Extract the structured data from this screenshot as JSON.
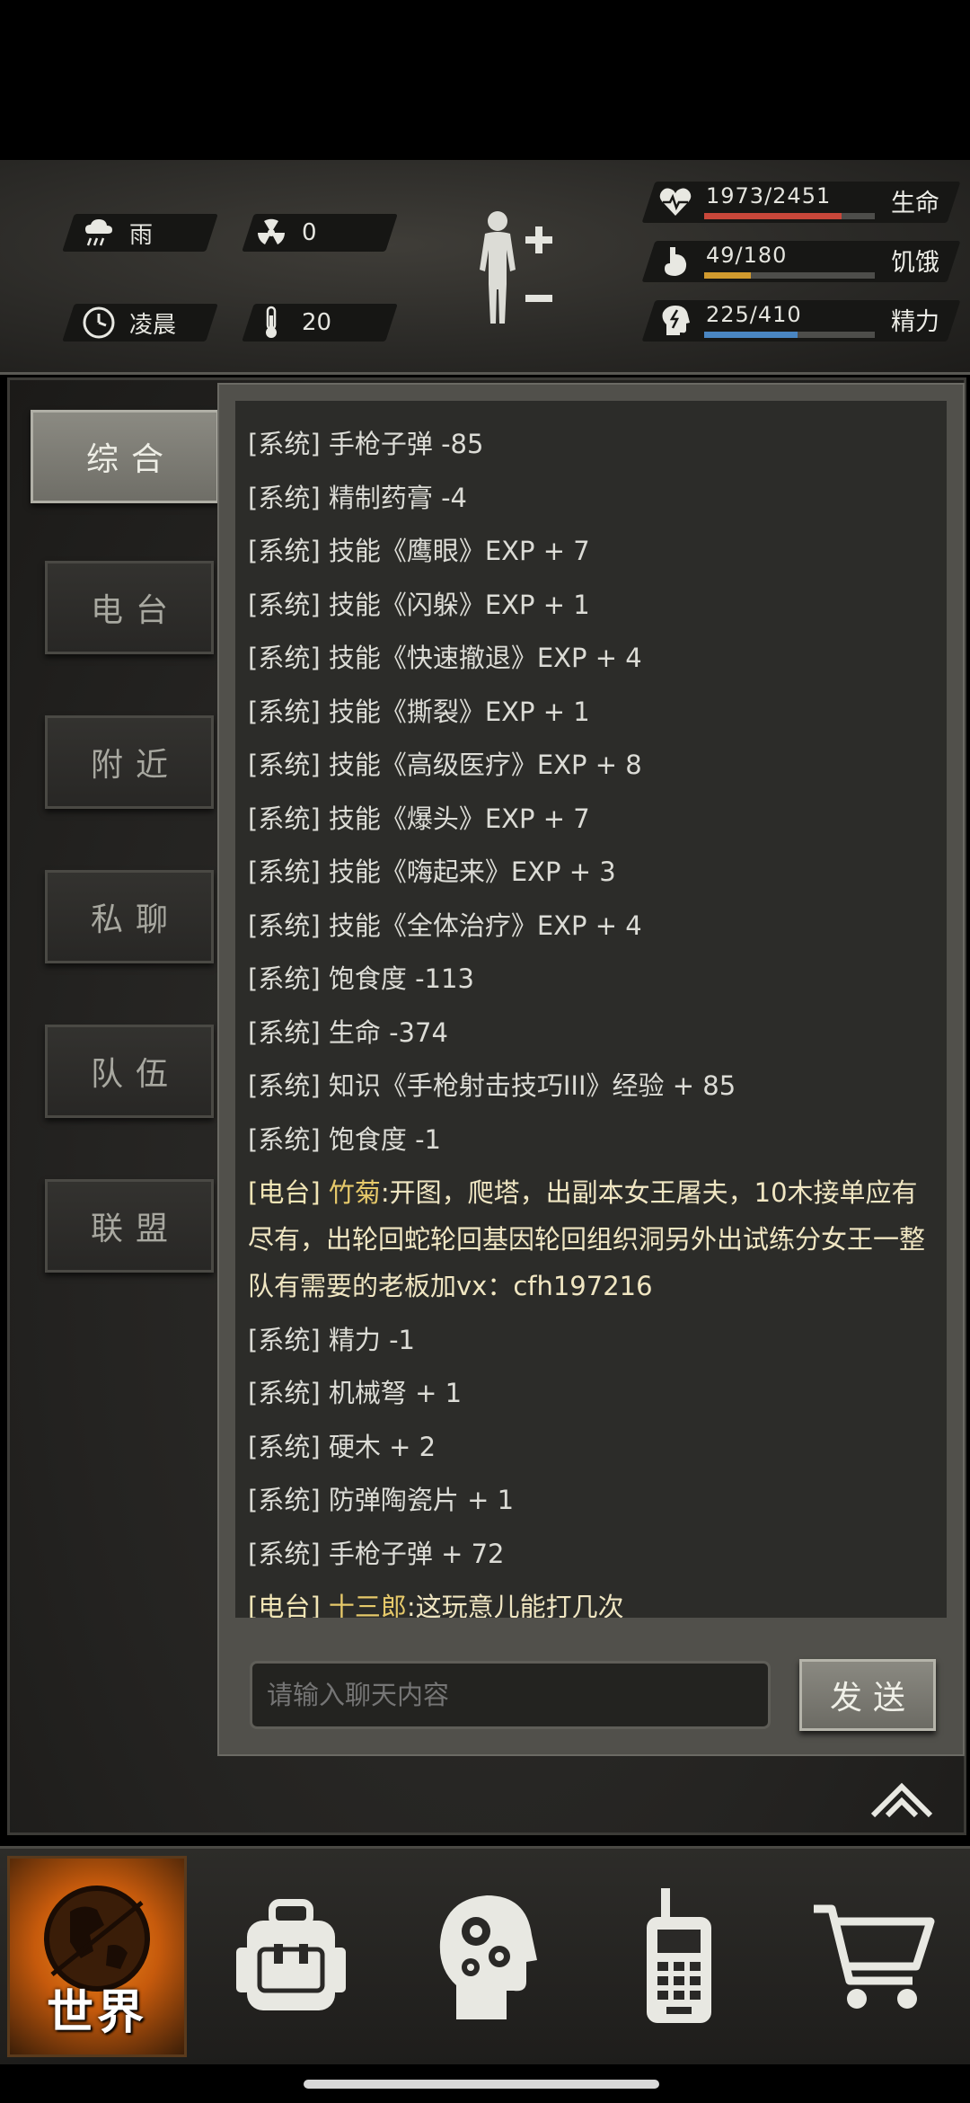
{
  "status": {
    "weather": "雨",
    "radiation": "0",
    "time_of_day": "凌晨",
    "temperature": "20",
    "stats": [
      {
        "value": "1973/2451",
        "label": "生命",
        "color": "#c8473a",
        "fraction": 0.805
      },
      {
        "value": "49/180",
        "label": "饥饿",
        "color": "#d19a2e",
        "fraction": 0.272
      },
      {
        "value": "225/410",
        "label": "精力",
        "color": "#4a86c2",
        "fraction": 0.549
      }
    ]
  },
  "tabs": [
    {
      "label": "综合",
      "active": true
    },
    {
      "label": "电台",
      "active": false
    },
    {
      "label": "附近",
      "active": false
    },
    {
      "label": "私聊",
      "active": false
    },
    {
      "label": "队伍",
      "active": false
    },
    {
      "label": "联盟",
      "active": false
    }
  ],
  "chat": {
    "messages": [
      {
        "tag": "[系统]",
        "text": "手枪子弹 -85"
      },
      {
        "tag": "[系统]",
        "text": "精制药膏 -4"
      },
      {
        "tag": "[系统]",
        "text": "技能《鹰眼》EXP + 7"
      },
      {
        "tag": "[系统]",
        "text": "技能《闪躲》EXP + 1"
      },
      {
        "tag": "[系统]",
        "text": "技能《快速撤退》EXP + 4"
      },
      {
        "tag": "[系统]",
        "text": "技能《撕裂》EXP + 1"
      },
      {
        "tag": "[系统]",
        "text": "技能《高级医疗》EXP + 8"
      },
      {
        "tag": "[系统]",
        "text": "技能《爆头》EXP + 7"
      },
      {
        "tag": "[系统]",
        "text": "技能《嗨起来》EXP + 3"
      },
      {
        "tag": "[系统]",
        "text": "技能《全体治疗》EXP + 4"
      },
      {
        "tag": "[系统]",
        "text": "饱食度 -113"
      },
      {
        "tag": "[系统]",
        "text": "生命 -374"
      },
      {
        "tag": "[系统]",
        "text": "知识《手枪射击技巧III》经验 + 85"
      },
      {
        "tag": "[系统]",
        "text": "饱食度 -1"
      },
      {
        "tag": "[电台]",
        "name": "竹菊",
        "text": ":开图，爬塔，出副本女王屠夫，10木接单应有尽有，出轮回蛇轮回基因轮回组织洞另外出试练分女王一整队有需要的老板加vx：cfh197216"
      },
      {
        "tag": "[系统]",
        "text": "精力 -1"
      },
      {
        "tag": "[系统]",
        "text": "机械弩 + 1"
      },
      {
        "tag": "[系统]",
        "text": "硬木 + 2"
      },
      {
        "tag": "[系统]",
        "text": "防弹陶瓷片 + 1"
      },
      {
        "tag": "[系统]",
        "text": "手枪子弹 + 72"
      },
      {
        "tag": "[电台]",
        "name": "十三郎",
        "text": ":这玩意儿能打几次"
      }
    ],
    "input_placeholder": "请输入聊天内容",
    "send_label": "发送"
  },
  "bottom_nav": {
    "world_label": "世界",
    "items": [
      "world-globe-icon",
      "backpack-icon",
      "skills-head-icon",
      "radio-walkie-talkie-icon",
      "shop-cart-icon"
    ]
  },
  "colors": {
    "radio_name": "#e6c96a",
    "active_nav": "#e07a18"
  }
}
